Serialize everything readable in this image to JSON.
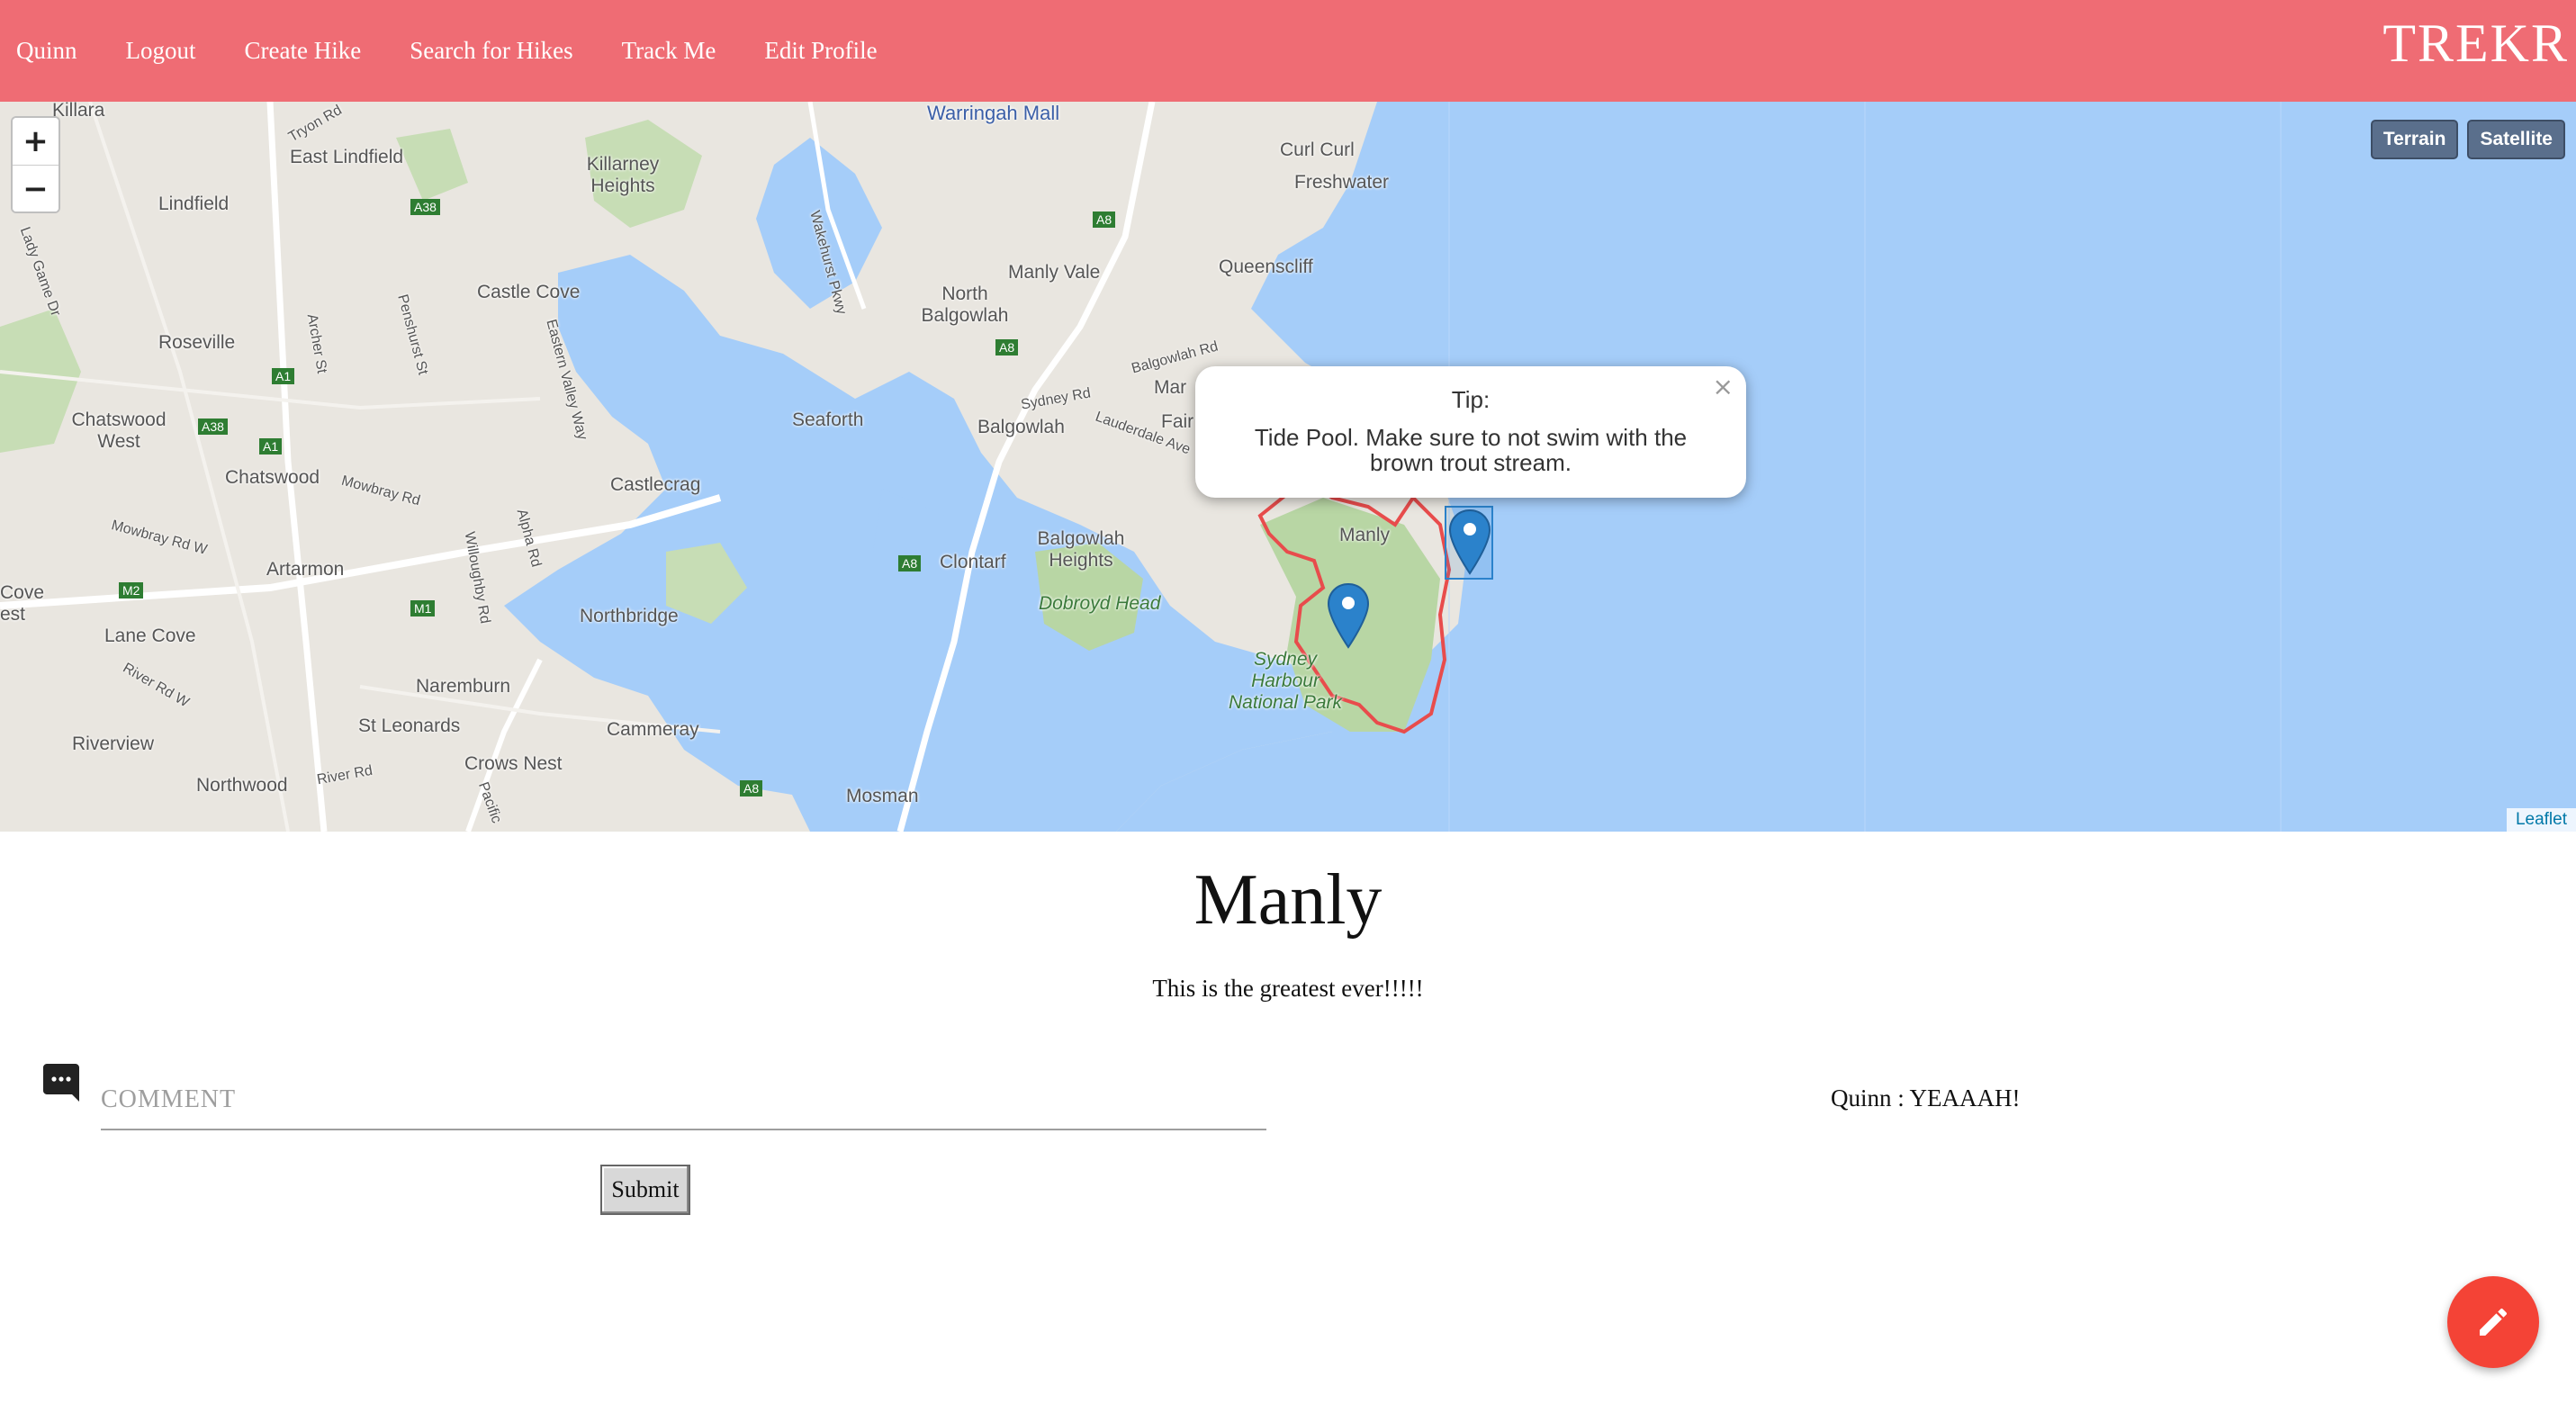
{
  "nav": {
    "items": [
      {
        "label": "Quinn"
      },
      {
        "label": "Logout"
      },
      {
        "label": "Create Hike"
      },
      {
        "label": "Search for Hikes"
      },
      {
        "label": "Track Me"
      },
      {
        "label": "Edit Profile"
      }
    ],
    "brand": "TREKR"
  },
  "map": {
    "zoom_in": "+",
    "zoom_out": "−",
    "layers": [
      "Terrain",
      "Satellite"
    ],
    "attribution": "Leaflet",
    "popup": {
      "title": "Tip:",
      "body": "Tide Pool. Make sure to not swim with the brown trout stream.",
      "close": "×"
    },
    "labels": {
      "killara": "Killara",
      "east_lindfield": "East Lindfield",
      "lindfield": "Lindfield",
      "killarney_heights": "Killarney Heights",
      "warringah_mall": "Warringah Mall",
      "curl_curl": "Curl Curl",
      "freshwater": "Freshwater",
      "queenscliff": "Queenscliff",
      "manly_vale": "Manly Vale",
      "north_balgowlah": "North Balgowlah",
      "castle_cove": "Castle Cove",
      "roseville": "Roseville",
      "chatswood_west": "Chatswood West",
      "chatswood": "Chatswood",
      "seaforth": "Seaforth",
      "balgowlah": "Balgowlah",
      "castlecrag": "Castlecrag",
      "balgowlah_heights": "Balgowlah Heights",
      "clontarf": "Clontarf",
      "dobroyd_head": "Dobroyd Head",
      "manly": "Manly",
      "sydney_harbour_np": "Sydney Harbour National Park",
      "artarmon": "Artarmon",
      "lane_cove": "Lane Cove",
      "northbridge": "Northbridge",
      "naremburn": "Naremburn",
      "st_leonards": "St Leonards",
      "cammeray": "Cammeray",
      "crows_nest": "Crows Nest",
      "riverview": "Riverview",
      "northwood": "Northwood",
      "mosman": "Mosman",
      "cove": "Cove",
      "est": "est",
      "fair": "Fair",
      "mar": "Mar"
    },
    "roads": {
      "a38_top": "A38",
      "a8_top": "A8",
      "a8_mid": "A8",
      "a1_a": "A1",
      "a38_left": "A38",
      "a1_b": "A1",
      "m2": "M2",
      "m1": "M1",
      "a8_low": "A8",
      "a8_bottom": "A8",
      "mowbray_rd": "Mowbray Rd",
      "mowbray_rd_w": "Mowbray Rd W",
      "archer_st": "Archer St",
      "penshurst_st": "Penshurst St",
      "eastern_valley_way": "Eastern Valley Way",
      "alpha_rd": "Alpha Rd",
      "willoughby_rd": "Willoughby Rd",
      "river_rd_w": "River Rd W",
      "river_rd": "River Rd",
      "pacific": "Pacific",
      "wakehurst_pkwy": "Wakehurst Pkwy",
      "sydney_rd": "Sydney Rd",
      "balgowlah_rd": "Balgowlah Rd",
      "lauderdale_ave": "Lauderdale Ave",
      "tryon_rd": "Tryon Rd",
      "lady_game_dr": "Lady Game Dr"
    }
  },
  "hike": {
    "title": "Manly",
    "description": "This is the greatest ever!!!!!"
  },
  "comment_form": {
    "placeholder": "COMMENT",
    "submit_label": "Submit"
  },
  "comments": [
    {
      "text": "Quinn : YEAAAH!"
    }
  ],
  "colors": {
    "navbar": "#ef6c74",
    "water": "#a5cdf9",
    "land": "#e9e6e0",
    "park": "#b8d6a4",
    "route": "#e84c4c",
    "marker": "#2b82cb",
    "fab": "#f44336"
  }
}
